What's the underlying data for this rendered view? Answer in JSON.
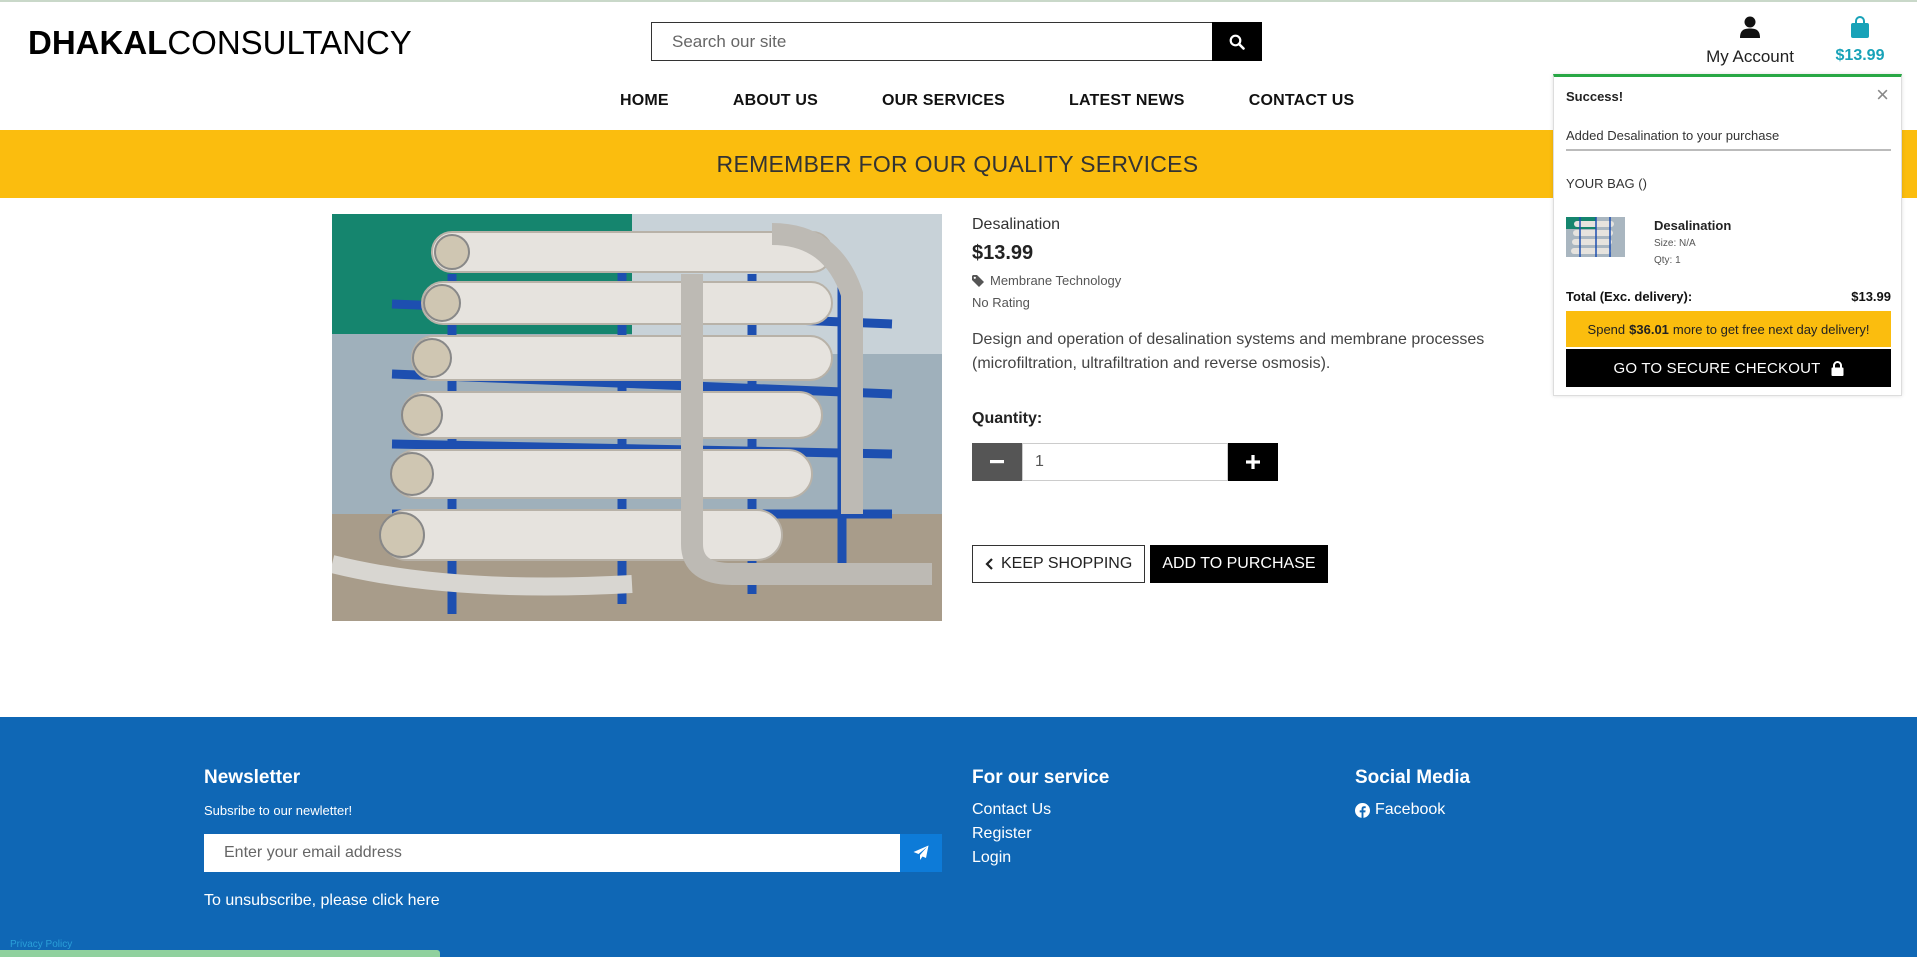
{
  "header": {
    "logo_bold": "DHAKAL",
    "logo_rest": "CONSULTANCY",
    "search_placeholder": "Search our site",
    "account_label": "My Account",
    "bag_total": "$13.99"
  },
  "nav": {
    "items": [
      "HOME",
      "ABOUT US",
      "OUR SERVICES",
      "LATEST NEWS",
      "CONTACT US"
    ]
  },
  "banner": {
    "text": "REMEMBER FOR OUR QUALITY SERVICES"
  },
  "product": {
    "name": "Desalination",
    "price": "$13.99",
    "category": "Membrane Technology",
    "rating": "No Rating",
    "description": "Design and operation of desalination systems and membrane processes (microfiltration, ultrafiltration and reverse osmosis).",
    "quantity_label": "Quantity:",
    "quantity_value": "1",
    "keep_shopping_label": "KEEP SHOPPING",
    "add_label": "ADD TO PURCHASE"
  },
  "toast": {
    "heading": "Success!",
    "close": "×",
    "message": "Added Desalination to your purchase",
    "bag_label": "YOUR BAG ()",
    "item_name": "Desalination",
    "item_size": "Size: N/A",
    "item_qty": "Qty: 1",
    "total_label": "Total (Exc. delivery):",
    "total_value": "$13.99",
    "spend_prefix": "Spend",
    "spend_amount": "$36.01",
    "spend_suffix": "more to get free next day delivery!",
    "checkout_label": "GO TO SECURE CHECKOUT"
  },
  "footer": {
    "newsletter_title": "Newsletter",
    "newsletter_sub": "Subsribe to our newletter!",
    "email_placeholder": "Enter your email address",
    "unsubscribe": "To unsubscribe, please click here",
    "service_title": "For our service",
    "service_links": [
      "Contact Us",
      "Register",
      "Login"
    ],
    "social_title": "Social Media",
    "social_facebook": "Facebook"
  },
  "bottom_link": "Privacy Policy",
  "colors": {
    "accent_yellow": "#fbbd0e",
    "footer_blue": "#0f67b5",
    "bag_teal": "#17a2b8",
    "success_green": "#28a745"
  }
}
